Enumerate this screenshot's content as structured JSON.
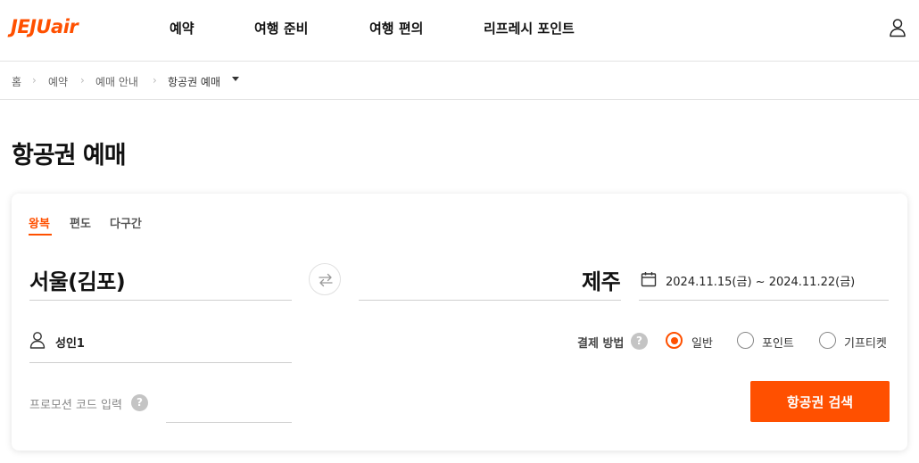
{
  "header": {
    "logo_jeju": "JEJU",
    "logo_air": "air",
    "nav": [
      "예약",
      "여행 준비",
      "여행 편의",
      "리프레시 포인트"
    ],
    "user_icon": "user-icon"
  },
  "breadcrumb": [
    "홈",
    "예약",
    "예매 안내",
    "항공권 예매"
  ],
  "page_title": "항공권 예매",
  "booking": {
    "trip_tabs": [
      "왕복",
      "편도",
      "다구간"
    ],
    "active_tab": "왕복",
    "origin": "서울(김포)",
    "destination": "제주",
    "swap_icon": "swap-icon",
    "dates": "2024.11.15(금) ~ 2024.11.22(금)",
    "passengers": "성인1",
    "payment_label": "결제 방법",
    "payment_options": [
      "일반",
      "포인트",
      "기프티켓"
    ],
    "payment_selected": "일반",
    "help_glyph": "?",
    "promo_label": "프로모션 코드 입력",
    "promo_value": "",
    "search_label": "항공권 검색"
  },
  "colors": {
    "brand": "#ff5000",
    "text": "#222222",
    "muted": "#888888",
    "divider": "#e3e3e3"
  }
}
